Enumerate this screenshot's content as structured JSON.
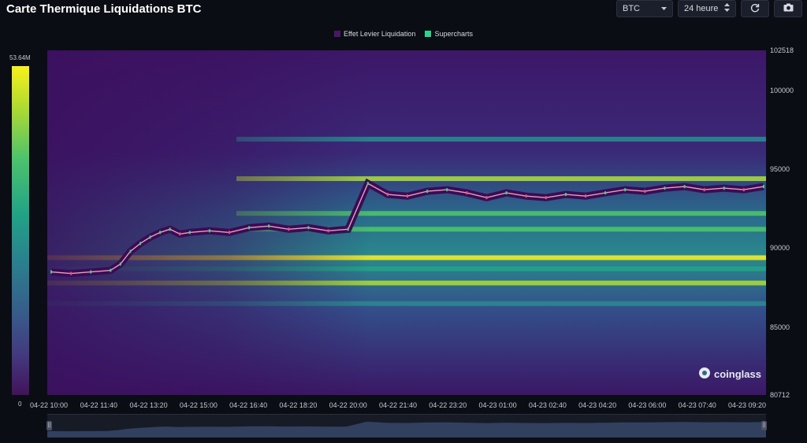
{
  "title": "Carte Thermique Liquidations BTC",
  "controls": {
    "symbol": "BTC",
    "period": "24 heure",
    "refresh_icon": "refresh-icon",
    "camera_icon": "camera-icon"
  },
  "legend": [
    {
      "label": "Effet Levier Liquidation",
      "color": "#4a1766"
    },
    {
      "label": "Supercharts",
      "color": "#2bd48a"
    }
  ],
  "colorbar": {
    "max_label": "53.64M",
    "min_label": "0"
  },
  "watermark": "coinglass",
  "chart_data": {
    "type": "heatmap",
    "title": "Carte Thermique Liquidations BTC",
    "y_ticks": [
      "102518",
      "100000",
      "95000",
      "90000",
      "85000",
      "80712"
    ],
    "y_range": [
      80712,
      102518
    ],
    "x_ticks": [
      "04-22 10:00",
      "04-22 11:40",
      "04-22 13:20",
      "04-22 15:00",
      "04-22 16:40",
      "04-22 18:20",
      "04-22 20:00",
      "04-22 21:40",
      "04-22 23:20",
      "04-23 01:00",
      "04-23 02:40",
      "04-23 04:20",
      "04-23 06:00",
      "04-23 07:40",
      "04-23 09:20"
    ],
    "colorbar_range": [
      0,
      53.64
    ],
    "colorbar_unit": "M",
    "series": [
      {
        "name": "Supercharts",
        "type": "line",
        "x_index": [
          0,
          2,
          4,
          6,
          7,
          8,
          9,
          10,
          11,
          12,
          13,
          14,
          16,
          18,
          20,
          22,
          24,
          26,
          28,
          30,
          32,
          34,
          36,
          38,
          40,
          42,
          44,
          46,
          48,
          50,
          52,
          54,
          56,
          58,
          60,
          62,
          64,
          66,
          68,
          70,
          72
        ],
        "values": [
          88500,
          88400,
          88500,
          88600,
          89000,
          89800,
          90300,
          90700,
          91000,
          91200,
          90900,
          91000,
          91100,
          91000,
          91300,
          91400,
          91200,
          91300,
          91100,
          91200,
          94100,
          93400,
          93300,
          93600,
          93700,
          93500,
          93200,
          93500,
          93300,
          93200,
          93400,
          93300,
          93500,
          93700,
          93600,
          93800,
          93900,
          93700,
          93800,
          93700,
          93900
        ]
      }
    ],
    "bands": [
      {
        "price": 89400,
        "intensity": 1.0
      },
      {
        "price": 87800,
        "intensity": 0.85
      },
      {
        "price": 92200,
        "intensity": 0.7
      },
      {
        "price": 91200,
        "intensity": 0.75
      },
      {
        "price": 94400,
        "intensity": 0.8
      },
      {
        "price": 88700,
        "intensity": 0.55
      },
      {
        "price": 96900,
        "intensity": 0.35
      },
      {
        "price": 86500,
        "intensity": 0.4
      }
    ]
  }
}
